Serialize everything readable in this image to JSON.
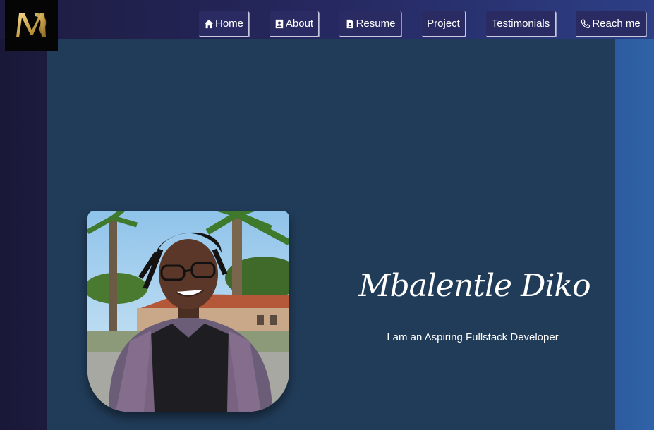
{
  "nav": {
    "items": [
      {
        "label": "Home",
        "icon": "home-icon"
      },
      {
        "label": "About",
        "icon": "contact-card-icon"
      },
      {
        "label": "Resume",
        "icon": "document-icon"
      },
      {
        "label": "Project",
        "icon": ""
      },
      {
        "label": "Testimonials",
        "icon": ""
      },
      {
        "label": "Reach me",
        "icon": "phone-icon"
      }
    ]
  },
  "hero": {
    "name": "Mbalentle Diko",
    "tagline": "I am an Aspiring Fullstack Developer"
  },
  "colors": {
    "panel": "#213c59",
    "nav_button": "#2b2b63",
    "logo_gold": "#c9a24a"
  }
}
